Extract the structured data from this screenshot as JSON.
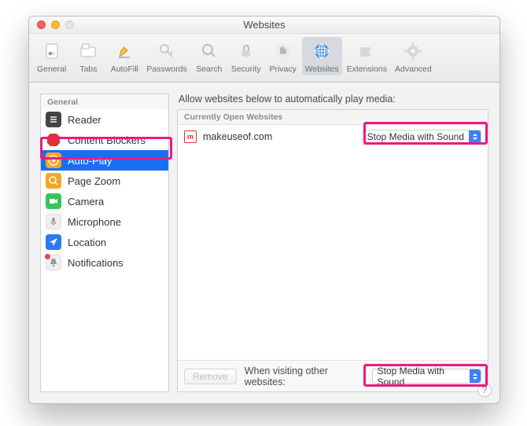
{
  "window": {
    "title": "Websites"
  },
  "toolbar": {
    "items": [
      {
        "label": "General"
      },
      {
        "label": "Tabs"
      },
      {
        "label": "AutoFill"
      },
      {
        "label": "Passwords"
      },
      {
        "label": "Search"
      },
      {
        "label": "Security"
      },
      {
        "label": "Privacy"
      },
      {
        "label": "Websites"
      },
      {
        "label": "Extensions"
      },
      {
        "label": "Advanced"
      }
    ]
  },
  "sidebar": {
    "header": "General",
    "items": [
      {
        "label": "Reader"
      },
      {
        "label": "Content Blockers"
      },
      {
        "label": "Auto-Play"
      },
      {
        "label": "Page Zoom"
      },
      {
        "label": "Camera"
      },
      {
        "label": "Microphone"
      },
      {
        "label": "Location"
      },
      {
        "label": "Notifications"
      }
    ],
    "selected_index": 2
  },
  "main": {
    "description": "Allow websites below to automatically play media:",
    "column_header": "Currently Open Websites",
    "rows": [
      {
        "favicon_letter": "m",
        "site": "makeuseof.com",
        "setting": "Stop Media with Sound"
      }
    ],
    "footer": {
      "remove_label": "Remove",
      "other_label": "When visiting other websites:",
      "other_setting": "Stop Media with Sound"
    }
  },
  "help": "?"
}
